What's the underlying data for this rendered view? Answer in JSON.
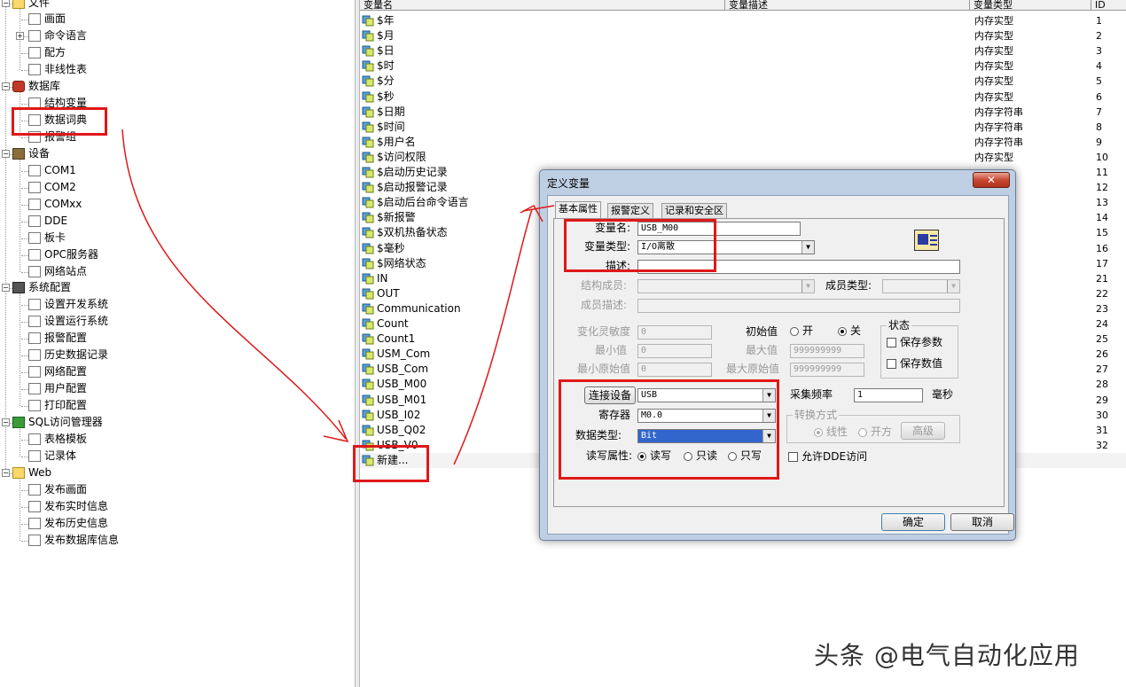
{
  "tree": {
    "items": [
      {
        "label": "文件",
        "icon": "folder-icon"
      },
      {
        "label": "画面",
        "icon": "screen-icon"
      },
      {
        "label": "命令语言",
        "icon": "command-language-icon"
      },
      {
        "label": "配方",
        "icon": "recipe-icon"
      },
      {
        "label": "非线性表",
        "icon": "nonlinear-table-icon"
      },
      {
        "label": "数据库",
        "icon": "database-icon"
      },
      {
        "label": "结构变量",
        "icon": "struct-variable-icon"
      },
      {
        "label": "数据词典",
        "icon": "data-dictionary-icon"
      },
      {
        "label": "报警组",
        "icon": "alarm-group-icon"
      },
      {
        "label": "设备",
        "icon": "device-icon"
      },
      {
        "label": "COM1",
        "icon": "com-port-icon"
      },
      {
        "label": "COM2",
        "icon": "com-port-icon"
      },
      {
        "label": "COMxx",
        "icon": "com-port-icon"
      },
      {
        "label": "DDE",
        "icon": "dde-icon"
      },
      {
        "label": "板卡",
        "icon": "board-card-icon"
      },
      {
        "label": "OPC服务器",
        "icon": "opc-server-icon"
      },
      {
        "label": "网络站点",
        "icon": "network-site-icon"
      },
      {
        "label": "系统配置",
        "icon": "tools-icon"
      },
      {
        "label": "设置开发系统",
        "icon": "dev-system-icon"
      },
      {
        "label": "设置运行系统",
        "icon": "run-system-icon"
      },
      {
        "label": "报警配置",
        "icon": "alarm-config-icon"
      },
      {
        "label": "历史数据记录",
        "icon": "history-record-icon"
      },
      {
        "label": "网络配置",
        "icon": "network-config-icon"
      },
      {
        "label": "用户配置",
        "icon": "user-config-icon"
      },
      {
        "label": "打印配置",
        "icon": "printer-icon"
      },
      {
        "label": "SQL访问管理器",
        "icon": "sql-manager-icon"
      },
      {
        "label": "表格模板",
        "icon": "table-template-icon"
      },
      {
        "label": "记录体",
        "icon": "record-body-icon"
      },
      {
        "label": "Web",
        "icon": "folder-icon"
      },
      {
        "label": "发布画面",
        "icon": "publish-screen-icon"
      },
      {
        "label": "发布实时信息",
        "icon": "publish-realtime-icon"
      },
      {
        "label": "发布历史信息",
        "icon": "publish-history-icon"
      },
      {
        "label": "发布数据库信息",
        "icon": "publish-database-icon"
      }
    ]
  },
  "list": {
    "headers": [
      "变量名",
      "变量描述",
      "变量类型",
      "ID"
    ],
    "rows": [
      {
        "name": "$年",
        "type": "内存实型",
        "id": "1"
      },
      {
        "name": "$月",
        "type": "内存实型",
        "id": "2"
      },
      {
        "name": "$日",
        "type": "内存实型",
        "id": "3"
      },
      {
        "name": "$时",
        "type": "内存实型",
        "id": "4"
      },
      {
        "name": "$分",
        "type": "内存实型",
        "id": "5"
      },
      {
        "name": "$秒",
        "type": "内存实型",
        "id": "6"
      },
      {
        "name": "$日期",
        "type": "内存字符串",
        "id": "7"
      },
      {
        "name": "$时间",
        "type": "内存字符串",
        "id": "8"
      },
      {
        "name": "$用户名",
        "type": "内存字符串",
        "id": "9"
      },
      {
        "name": "$访问权限",
        "type": "内存实型",
        "id": "10"
      },
      {
        "name": "$启动历史记录",
        "type": "",
        "id": "11"
      },
      {
        "name": "$启动报警记录",
        "type": "",
        "id": "12"
      },
      {
        "name": "$启动后台命令语言",
        "type": "",
        "id": "13"
      },
      {
        "name": "$新报警",
        "type": "",
        "id": "14"
      },
      {
        "name": "$双机热备状态",
        "type": "",
        "id": "15"
      },
      {
        "name": "$毫秒",
        "type": "",
        "id": "16"
      },
      {
        "name": "$网络状态",
        "type": "",
        "id": "17"
      },
      {
        "name": "IN",
        "type": "",
        "id": "21"
      },
      {
        "name": "OUT",
        "type": "",
        "id": "22"
      },
      {
        "name": "Communication",
        "type": "",
        "id": "23"
      },
      {
        "name": "Count",
        "type": "",
        "id": "24"
      },
      {
        "name": "Count1",
        "type": "",
        "id": "25"
      },
      {
        "name": "USM_Com",
        "type": "",
        "id": "26"
      },
      {
        "name": "USB_Com",
        "type": "",
        "id": "27"
      },
      {
        "name": "USB_M00",
        "type": "",
        "id": "28"
      },
      {
        "name": "USB_M01",
        "type": "",
        "id": "29"
      },
      {
        "name": "USB_I02",
        "type": "",
        "id": "30"
      },
      {
        "name": "USB_Q02",
        "type": "",
        "id": "31"
      },
      {
        "name": "USB_V0",
        "type": "",
        "id": "32"
      }
    ],
    "new_item": "新建..."
  },
  "dialog": {
    "title": "定义变量",
    "close": "✕",
    "tabs": [
      "基本属性",
      "报警定义",
      "记录和安全区"
    ],
    "var_name_label": "变量名:",
    "var_name_value": "USB_M00",
    "var_type_label": "变量类型:",
    "var_type_value": "I/O离散",
    "desc_label": "描述:",
    "struct_member_label": "结构成员:",
    "member_type_label": "成员类型:",
    "member_desc_label": "成员描述:",
    "sensitivity_label": "变化灵敏度",
    "sensitivity_value": "0",
    "min_label": "最小值",
    "min_value": "0",
    "min_raw_label": "最小原始值",
    "min_raw_value": "0",
    "initial_label": "初始值",
    "on_label": "开",
    "off_label": "关",
    "max_label": "最大值",
    "max_value": "999999999",
    "max_raw_label": "最大原始值",
    "max_raw_value": "999999999",
    "state_group": "状态",
    "save_param": "保存参数",
    "save_value": "保存数值",
    "device_button": "连接设备",
    "device_value": "USB",
    "register_label": "寄存器",
    "register_value": "M0.0",
    "datatype_label": "数据类型:",
    "datatype_value": "Bit",
    "rw_label": "读写属性:",
    "rw_options": [
      "读写",
      "只读",
      "只写"
    ],
    "sample_label": "采集频率",
    "sample_value": "1",
    "ms_label": "毫秒",
    "convert_group": "转换方式",
    "linear_label": "线性",
    "sqrt_label": "开方",
    "advanced_button": "高级",
    "allow_dde": "允许DDE访问",
    "ok": "确定",
    "cancel": "取消"
  },
  "watermark": "头条 @电气自动化应用",
  "colors": {
    "highlight": "#e01818",
    "selection": "#3366cc",
    "dialog_frame": "#bfcfe3"
  }
}
